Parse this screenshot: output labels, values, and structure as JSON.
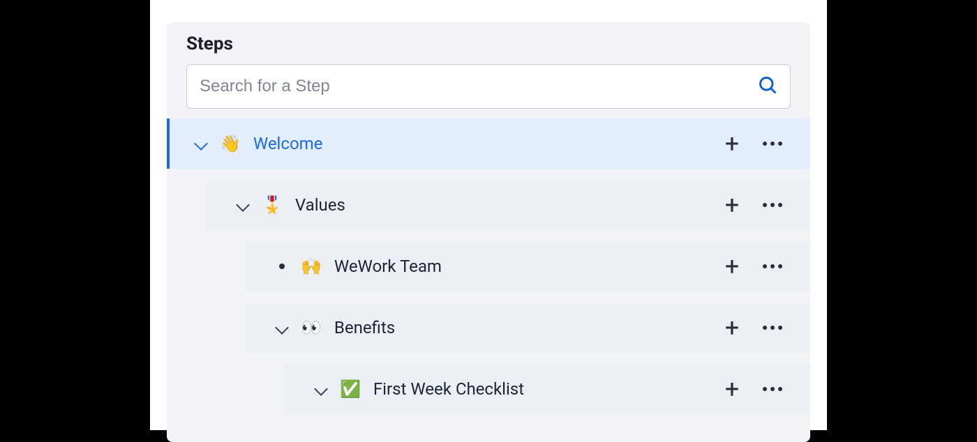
{
  "panel": {
    "title": "Steps"
  },
  "search": {
    "placeholder": "Search for a Step"
  },
  "steps": [
    {
      "emoji": "👋",
      "label": "Welcome",
      "level": 0,
      "active": true,
      "marker": "chevron"
    },
    {
      "emoji": "🎖️",
      "label": "Values",
      "level": 1,
      "active": false,
      "marker": "chevron"
    },
    {
      "emoji": "🙌",
      "label": "WeWork Team",
      "level": 2,
      "active": false,
      "marker": "bullet"
    },
    {
      "emoji": "👀",
      "label": "Benefits",
      "level": 3,
      "active": false,
      "marker": "chevron"
    },
    {
      "emoji": "✅",
      "label": "First Week Checklist",
      "level": 4,
      "active": false,
      "marker": "chevron"
    }
  ]
}
